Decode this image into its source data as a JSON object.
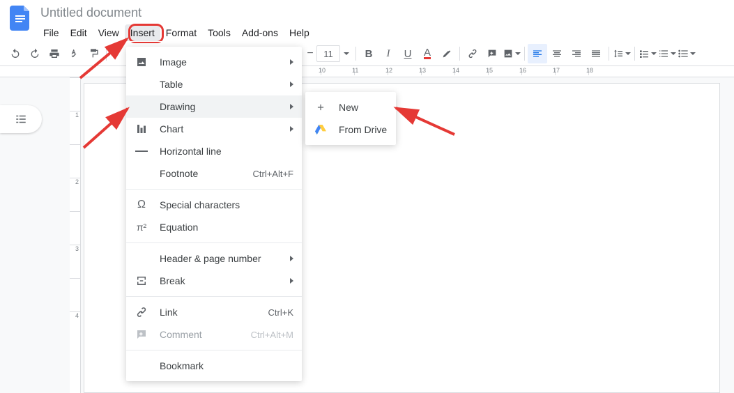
{
  "header": {
    "doc_title": "Untitled document",
    "menus": {
      "file": "File",
      "edit": "Edit",
      "view": "View",
      "insert": "Insert",
      "format": "Format",
      "tools": "Tools",
      "addons": "Add-ons",
      "help": "Help"
    }
  },
  "toolbar": {
    "font_size": "11"
  },
  "insert_menu": {
    "image": "Image",
    "table": "Table",
    "drawing": "Drawing",
    "chart": "Chart",
    "horizontal_line": "Horizontal line",
    "footnote": "Footnote",
    "footnote_shortcut": "Ctrl+Alt+F",
    "special_chars": "Special characters",
    "equation": "Equation",
    "header_page_number": "Header & page number",
    "break": "Break",
    "link": "Link",
    "link_shortcut": "Ctrl+K",
    "comment": "Comment",
    "comment_shortcut": "Ctrl+Alt+M",
    "bookmark": "Bookmark"
  },
  "drawing_submenu": {
    "new": "New",
    "from_drive": "From Drive"
  },
  "ruler": {
    "ticks": [
      "10",
      "11",
      "12",
      "13",
      "14",
      "15",
      "16",
      "17",
      "18"
    ]
  },
  "vruler": {
    "ticks": [
      "",
      "1",
      "",
      "2",
      "",
      "3",
      "",
      "4"
    ]
  }
}
